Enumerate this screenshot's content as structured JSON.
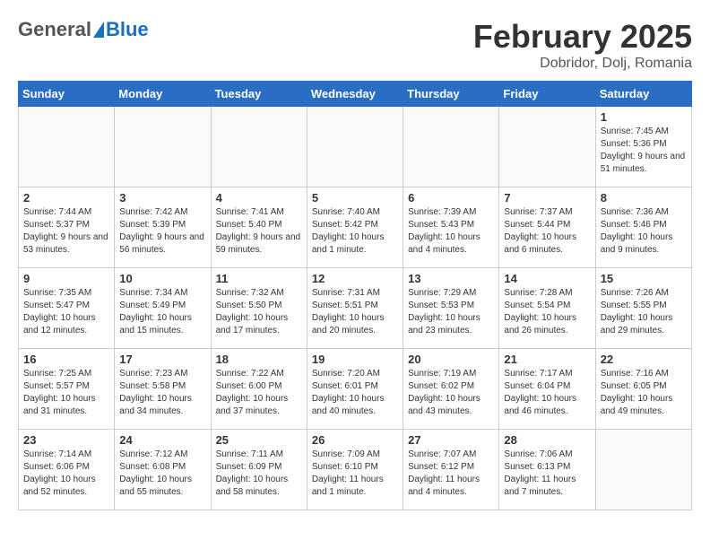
{
  "header": {
    "logo_general": "General",
    "logo_blue": "Blue",
    "month_title": "February 2025",
    "location": "Dobridor, Dolj, Romania"
  },
  "days_of_week": [
    "Sunday",
    "Monday",
    "Tuesday",
    "Wednesday",
    "Thursday",
    "Friday",
    "Saturday"
  ],
  "weeks": [
    [
      {
        "day": "",
        "info": ""
      },
      {
        "day": "",
        "info": ""
      },
      {
        "day": "",
        "info": ""
      },
      {
        "day": "",
        "info": ""
      },
      {
        "day": "",
        "info": ""
      },
      {
        "day": "",
        "info": ""
      },
      {
        "day": "1",
        "info": "Sunrise: 7:45 AM\nSunset: 5:36 PM\nDaylight: 9 hours and 51 minutes."
      }
    ],
    [
      {
        "day": "2",
        "info": "Sunrise: 7:44 AM\nSunset: 5:37 PM\nDaylight: 9 hours and 53 minutes."
      },
      {
        "day": "3",
        "info": "Sunrise: 7:42 AM\nSunset: 5:39 PM\nDaylight: 9 hours and 56 minutes."
      },
      {
        "day": "4",
        "info": "Sunrise: 7:41 AM\nSunset: 5:40 PM\nDaylight: 9 hours and 59 minutes."
      },
      {
        "day": "5",
        "info": "Sunrise: 7:40 AM\nSunset: 5:42 PM\nDaylight: 10 hours and 1 minute."
      },
      {
        "day": "6",
        "info": "Sunrise: 7:39 AM\nSunset: 5:43 PM\nDaylight: 10 hours and 4 minutes."
      },
      {
        "day": "7",
        "info": "Sunrise: 7:37 AM\nSunset: 5:44 PM\nDaylight: 10 hours and 6 minutes."
      },
      {
        "day": "8",
        "info": "Sunrise: 7:36 AM\nSunset: 5:46 PM\nDaylight: 10 hours and 9 minutes."
      }
    ],
    [
      {
        "day": "9",
        "info": "Sunrise: 7:35 AM\nSunset: 5:47 PM\nDaylight: 10 hours and 12 minutes."
      },
      {
        "day": "10",
        "info": "Sunrise: 7:34 AM\nSunset: 5:49 PM\nDaylight: 10 hours and 15 minutes."
      },
      {
        "day": "11",
        "info": "Sunrise: 7:32 AM\nSunset: 5:50 PM\nDaylight: 10 hours and 17 minutes."
      },
      {
        "day": "12",
        "info": "Sunrise: 7:31 AM\nSunset: 5:51 PM\nDaylight: 10 hours and 20 minutes."
      },
      {
        "day": "13",
        "info": "Sunrise: 7:29 AM\nSunset: 5:53 PM\nDaylight: 10 hours and 23 minutes."
      },
      {
        "day": "14",
        "info": "Sunrise: 7:28 AM\nSunset: 5:54 PM\nDaylight: 10 hours and 26 minutes."
      },
      {
        "day": "15",
        "info": "Sunrise: 7:26 AM\nSunset: 5:55 PM\nDaylight: 10 hours and 29 minutes."
      }
    ],
    [
      {
        "day": "16",
        "info": "Sunrise: 7:25 AM\nSunset: 5:57 PM\nDaylight: 10 hours and 31 minutes."
      },
      {
        "day": "17",
        "info": "Sunrise: 7:23 AM\nSunset: 5:58 PM\nDaylight: 10 hours and 34 minutes."
      },
      {
        "day": "18",
        "info": "Sunrise: 7:22 AM\nSunset: 6:00 PM\nDaylight: 10 hours and 37 minutes."
      },
      {
        "day": "19",
        "info": "Sunrise: 7:20 AM\nSunset: 6:01 PM\nDaylight: 10 hours and 40 minutes."
      },
      {
        "day": "20",
        "info": "Sunrise: 7:19 AM\nSunset: 6:02 PM\nDaylight: 10 hours and 43 minutes."
      },
      {
        "day": "21",
        "info": "Sunrise: 7:17 AM\nSunset: 6:04 PM\nDaylight: 10 hours and 46 minutes."
      },
      {
        "day": "22",
        "info": "Sunrise: 7:16 AM\nSunset: 6:05 PM\nDaylight: 10 hours and 49 minutes."
      }
    ],
    [
      {
        "day": "23",
        "info": "Sunrise: 7:14 AM\nSunset: 6:06 PM\nDaylight: 10 hours and 52 minutes."
      },
      {
        "day": "24",
        "info": "Sunrise: 7:12 AM\nSunset: 6:08 PM\nDaylight: 10 hours and 55 minutes."
      },
      {
        "day": "25",
        "info": "Sunrise: 7:11 AM\nSunset: 6:09 PM\nDaylight: 10 hours and 58 minutes."
      },
      {
        "day": "26",
        "info": "Sunrise: 7:09 AM\nSunset: 6:10 PM\nDaylight: 11 hours and 1 minute."
      },
      {
        "day": "27",
        "info": "Sunrise: 7:07 AM\nSunset: 6:12 PM\nDaylight: 11 hours and 4 minutes."
      },
      {
        "day": "28",
        "info": "Sunrise: 7:06 AM\nSunset: 6:13 PM\nDaylight: 11 hours and 7 minutes."
      },
      {
        "day": "",
        "info": ""
      }
    ]
  ]
}
